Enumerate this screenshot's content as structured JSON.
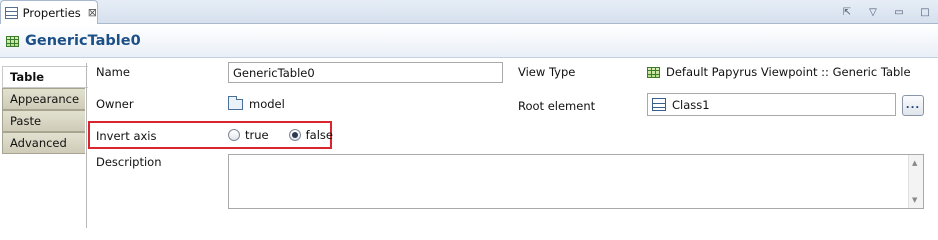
{
  "view_tab": {
    "title": "Properties",
    "close": "⊠"
  },
  "toolbar": {
    "new_view": "⇱",
    "menu": "▽",
    "minimize": "▭",
    "maximize": "□"
  },
  "header": {
    "title": "GenericTable0"
  },
  "side_tabs": [
    {
      "label": "Table",
      "active": true
    },
    {
      "label": "Appearance",
      "active": false
    },
    {
      "label": "Paste",
      "active": false
    },
    {
      "label": "Advanced",
      "active": false
    }
  ],
  "fields": {
    "name": {
      "label": "Name",
      "value": "GenericTable0"
    },
    "owner": {
      "label": "Owner",
      "value": "model"
    },
    "invert_axis": {
      "label": "Invert axis",
      "true_label": "true",
      "false_label": "false",
      "selected": "false"
    },
    "description": {
      "label": "Description",
      "value": ""
    },
    "view_type": {
      "label": "View Type",
      "value": "Default Papyrus Viewpoint :: Generic Table"
    },
    "root_element": {
      "label": "Root element",
      "value": "Class1",
      "browse_label": "..."
    }
  },
  "colors": {
    "highlight": "#d9262e",
    "title": "#1d4f87"
  }
}
